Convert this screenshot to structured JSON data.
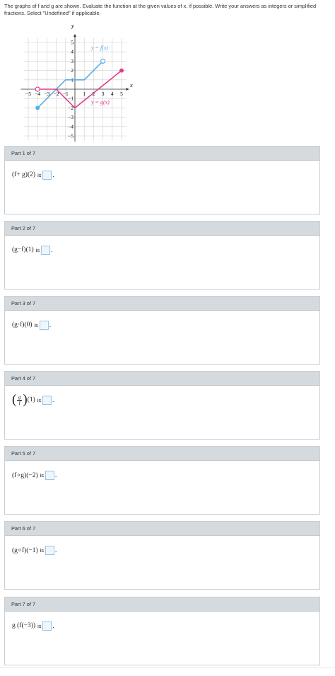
{
  "prompt": {
    "text": "The graphs of f and g are shown. Evaluate the function at the given values of x, if possible. Write your answers as integers or simplified fractions. Select \"Undefined\" if applicable."
  },
  "graph": {
    "axis_x_label": "x",
    "axis_y_label": "y",
    "x_ticks": [
      "−5",
      "−4",
      "−3",
      "−2",
      "−1",
      "1",
      "2",
      "3",
      "4",
      "5"
    ],
    "y_ticks": [
      "5",
      "4",
      "3",
      "2",
      "1",
      "−1",
      "−2",
      "−3",
      "−4",
      "−5"
    ],
    "f_label": "y = f(x)",
    "g_label": "y = g(x)",
    "colors": {
      "f": "#5aaee6",
      "g": "#dd3f8c",
      "grid": "#cfcfcf",
      "axis": "#333333"
    },
    "f_points": [
      [
        -4,
        -2
      ],
      [
        -1,
        1
      ],
      [
        0,
        1
      ],
      [
        1,
        1
      ],
      [
        3,
        3
      ]
    ],
    "f_endpoints": {
      "closed": [
        -4,
        -2
      ],
      "open": [
        3,
        3
      ]
    },
    "g_points": [
      [
        -4,
        0
      ],
      [
        -2,
        0
      ],
      [
        0,
        -2
      ],
      [
        5,
        2
      ]
    ],
    "g_endpoints": {
      "open": [
        -4,
        0
      ],
      "closed": [
        5,
        2
      ]
    }
  },
  "parts": [
    {
      "header": "Part 1 of 7",
      "expr": "(f+ g)(2)",
      "is": "is",
      "period": "."
    },
    {
      "header": "Part 2 of 7",
      "expr": "(g−f)(1)",
      "is": "is",
      "period": "."
    },
    {
      "header": "Part 3 of 7",
      "expr": "(g·f)(0)",
      "is": "is",
      "period": "."
    },
    {
      "header": "Part 4 of 7",
      "frac_num": "g",
      "frac_den": "f",
      "expr_after": "(1)",
      "is": "is",
      "period": "."
    },
    {
      "header": "Part 5 of 7",
      "expr": "(f∘g)(−2)",
      "is": "is",
      "period": "."
    },
    {
      "header": "Part 6 of 7",
      "expr": "(g∘f)(−1)",
      "is": "is",
      "period": "."
    },
    {
      "header": "Part 7 of 7",
      "expr": "g (f(−3))",
      "is": "is",
      "period": "."
    }
  ]
}
